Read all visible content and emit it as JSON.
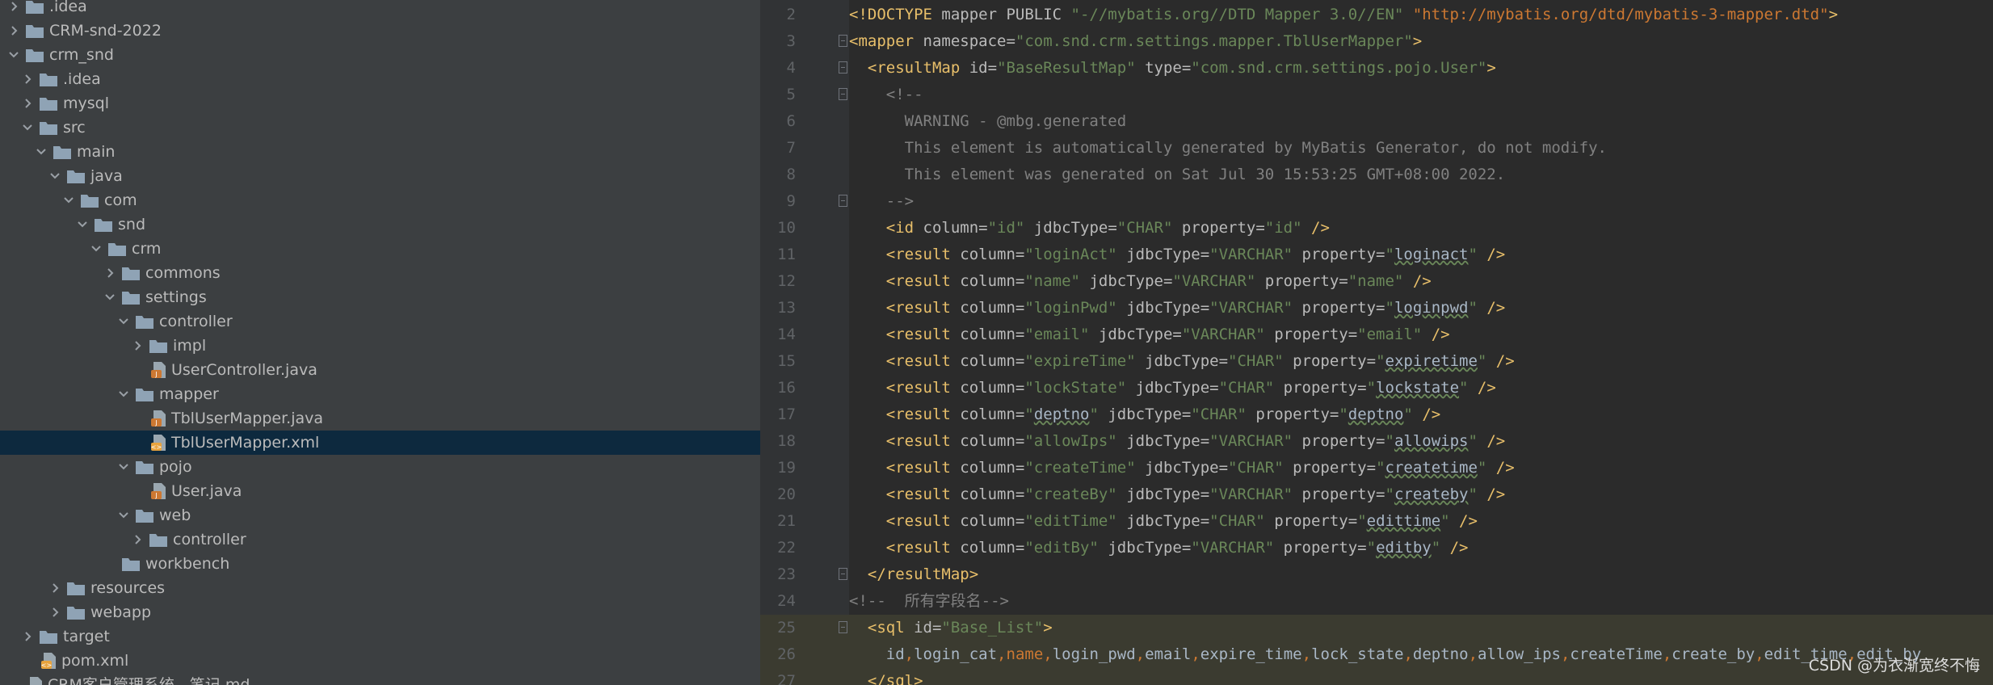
{
  "tree": [
    {
      "label": ".idea",
      "kind": "folder",
      "expanded": false,
      "depth": 0
    },
    {
      "label": "CRM-snd-2022",
      "kind": "folder",
      "expanded": false,
      "depth": 0
    },
    {
      "label": "crm_snd",
      "kind": "folder",
      "expanded": true,
      "depth": 0
    },
    {
      "label": ".idea",
      "kind": "folder",
      "expanded": false,
      "depth": 1
    },
    {
      "label": "mysql",
      "kind": "folder",
      "expanded": false,
      "depth": 1
    },
    {
      "label": "src",
      "kind": "folder",
      "expanded": true,
      "depth": 1
    },
    {
      "label": "main",
      "kind": "folder",
      "expanded": true,
      "depth": 2
    },
    {
      "label": "java",
      "kind": "folder",
      "expanded": true,
      "depth": 3
    },
    {
      "label": "com",
      "kind": "folder",
      "expanded": true,
      "depth": 4
    },
    {
      "label": "snd",
      "kind": "folder",
      "expanded": true,
      "depth": 5
    },
    {
      "label": "crm",
      "kind": "folder",
      "expanded": true,
      "depth": 6
    },
    {
      "label": "commons",
      "kind": "folder",
      "expanded": false,
      "depth": 7
    },
    {
      "label": "settings",
      "kind": "folder",
      "expanded": true,
      "depth": 7
    },
    {
      "label": "controller",
      "kind": "folder",
      "expanded": true,
      "depth": 8
    },
    {
      "label": "impl",
      "kind": "folder",
      "expanded": false,
      "depth": 9
    },
    {
      "label": "UserController.java",
      "kind": "java",
      "depth": 9
    },
    {
      "label": "mapper",
      "kind": "folder",
      "expanded": true,
      "depth": 8
    },
    {
      "label": "TblUserMapper.java",
      "kind": "java",
      "depth": 9
    },
    {
      "label": "TblUserMapper.xml",
      "kind": "xml",
      "depth": 9,
      "selected": true
    },
    {
      "label": "pojo",
      "kind": "folder",
      "expanded": true,
      "depth": 8
    },
    {
      "label": "User.java",
      "kind": "java",
      "depth": 9
    },
    {
      "label": "web",
      "kind": "folder",
      "expanded": true,
      "depth": 8
    },
    {
      "label": "controller",
      "kind": "folder",
      "expanded": false,
      "depth": 9
    },
    {
      "label": "workbench",
      "kind": "folder",
      "depth": 7
    },
    {
      "label": "resources",
      "kind": "folder",
      "expanded": false,
      "depth": 3
    },
    {
      "label": "webapp",
      "kind": "folder",
      "expanded": false,
      "depth": 3
    },
    {
      "label": "target",
      "kind": "folder",
      "expanded": false,
      "depth": 1
    },
    {
      "label": "pom.xml",
      "kind": "xml",
      "depth": 1
    },
    {
      "label": "CRM客户管理系统 - 笔记.md",
      "kind": "md",
      "depth": 0
    }
  ],
  "editor": {
    "lines": [
      {
        "n": "2",
        "fold": false,
        "tokens": [
          [
            "t",
            "<!DOCTYPE "
          ],
          [
            "a",
            "mapper PUBLIC "
          ],
          [
            "v",
            "\"-//mybatis.org//DTD Mapper 3.0//EN\" "
          ],
          [
            "u",
            "\"http://mybatis.org/dtd/mybatis-3-mapper.dtd\""
          ],
          [
            "t",
            ">"
          ]
        ]
      },
      {
        "n": "3",
        "fold": true,
        "tokens": [
          [
            "t",
            "<mapper "
          ],
          [
            "a",
            "namespace="
          ],
          [
            "v",
            "\"com.snd.crm.settings.mapper.TblUserMapper\""
          ],
          [
            "t",
            ">"
          ]
        ]
      },
      {
        "n": "4",
        "fold": true,
        "tokens": [
          [
            "f",
            "  "
          ],
          [
            "t",
            "<resultMap "
          ],
          [
            "a",
            "id="
          ],
          [
            "v",
            "\"BaseResultMap\" "
          ],
          [
            "a",
            "type="
          ],
          [
            "v",
            "\"com.snd.crm.settings.pojo.User\""
          ],
          [
            "t",
            ">"
          ]
        ]
      },
      {
        "n": "5",
        "fold": true,
        "tokens": [
          [
            "cm",
            "    <!--"
          ]
        ]
      },
      {
        "n": "6",
        "fold": false,
        "tokens": [
          [
            "cm",
            "      WARNING - @mbg.generated"
          ]
        ]
      },
      {
        "n": "7",
        "fold": false,
        "tokens": [
          [
            "cm",
            "      This element is automatically generated by MyBatis Generator, do not modify."
          ]
        ]
      },
      {
        "n": "8",
        "fold": false,
        "tokens": [
          [
            "cm",
            "      This element was generated on Sat Jul 30 15:53:25 GMT+08:00 2022."
          ]
        ]
      },
      {
        "n": "9",
        "fold": true,
        "tokens": [
          [
            "cm",
            "    -->"
          ]
        ]
      },
      {
        "n": "10",
        "fold": false,
        "tokens": [
          [
            "f",
            "    "
          ],
          [
            "t",
            "<id "
          ],
          [
            "a",
            "column="
          ],
          [
            "v",
            "\"id\" "
          ],
          [
            "a",
            "jdbcType="
          ],
          [
            "v",
            "\"CHAR\" "
          ],
          [
            "a",
            "property="
          ],
          [
            "v",
            "\"id\" "
          ],
          [
            "t",
            "/>"
          ]
        ]
      },
      {
        "n": "11",
        "fold": false,
        "tokens": [
          [
            "f",
            "    "
          ],
          [
            "t",
            "<result "
          ],
          [
            "a",
            "column="
          ],
          [
            "v",
            "\"loginAct\" "
          ],
          [
            "a",
            "jdbcType="
          ],
          [
            "v",
            "\"VARCHAR\" "
          ],
          [
            "a",
            "property="
          ],
          [
            "v",
            "\""
          ],
          [
            "sq",
            "loginact"
          ],
          [
            "v",
            "\" "
          ],
          [
            "t",
            "/>"
          ]
        ]
      },
      {
        "n": "12",
        "fold": false,
        "tokens": [
          [
            "f",
            "    "
          ],
          [
            "t",
            "<result "
          ],
          [
            "a",
            "column="
          ],
          [
            "v",
            "\"name\" "
          ],
          [
            "a",
            "jdbcType="
          ],
          [
            "v",
            "\"VARCHAR\" "
          ],
          [
            "a",
            "property="
          ],
          [
            "v",
            "\"name\" "
          ],
          [
            "t",
            "/>"
          ]
        ]
      },
      {
        "n": "13",
        "fold": false,
        "tokens": [
          [
            "f",
            "    "
          ],
          [
            "t",
            "<result "
          ],
          [
            "a",
            "column="
          ],
          [
            "v",
            "\"loginPwd\" "
          ],
          [
            "a",
            "jdbcType="
          ],
          [
            "v",
            "\"VARCHAR\" "
          ],
          [
            "a",
            "property="
          ],
          [
            "v",
            "\""
          ],
          [
            "sq",
            "loginpwd"
          ],
          [
            "v",
            "\" "
          ],
          [
            "t",
            "/>"
          ]
        ]
      },
      {
        "n": "14",
        "fold": false,
        "tokens": [
          [
            "f",
            "    "
          ],
          [
            "t",
            "<result "
          ],
          [
            "a",
            "column="
          ],
          [
            "v",
            "\"email\" "
          ],
          [
            "a",
            "jdbcType="
          ],
          [
            "v",
            "\"VARCHAR\" "
          ],
          [
            "a",
            "property="
          ],
          [
            "v",
            "\"email\" "
          ],
          [
            "t",
            "/>"
          ]
        ]
      },
      {
        "n": "15",
        "fold": false,
        "tokens": [
          [
            "f",
            "    "
          ],
          [
            "t",
            "<result "
          ],
          [
            "a",
            "column="
          ],
          [
            "v",
            "\"expireTime\" "
          ],
          [
            "a",
            "jdbcType="
          ],
          [
            "v",
            "\"CHAR\" "
          ],
          [
            "a",
            "property="
          ],
          [
            "v",
            "\""
          ],
          [
            "sq",
            "expiretime"
          ],
          [
            "v",
            "\" "
          ],
          [
            "t",
            "/>"
          ]
        ]
      },
      {
        "n": "16",
        "fold": false,
        "tokens": [
          [
            "f",
            "    "
          ],
          [
            "t",
            "<result "
          ],
          [
            "a",
            "column="
          ],
          [
            "v",
            "\"lockState\" "
          ],
          [
            "a",
            "jdbcType="
          ],
          [
            "v",
            "\"CHAR\" "
          ],
          [
            "a",
            "property="
          ],
          [
            "v",
            "\""
          ],
          [
            "sq",
            "lockstate"
          ],
          [
            "v",
            "\" "
          ],
          [
            "t",
            "/>"
          ]
        ]
      },
      {
        "n": "17",
        "fold": false,
        "tokens": [
          [
            "f",
            "    "
          ],
          [
            "t",
            "<result "
          ],
          [
            "a",
            "column="
          ],
          [
            "v",
            "\""
          ],
          [
            "sq",
            "deptno"
          ],
          [
            "v",
            "\" "
          ],
          [
            "a",
            "jdbcType="
          ],
          [
            "v",
            "\"CHAR\" "
          ],
          [
            "a",
            "property="
          ],
          [
            "v",
            "\""
          ],
          [
            "sq",
            "deptno"
          ],
          [
            "v",
            "\" "
          ],
          [
            "t",
            "/>"
          ]
        ]
      },
      {
        "n": "18",
        "fold": false,
        "tokens": [
          [
            "f",
            "    "
          ],
          [
            "t",
            "<result "
          ],
          [
            "a",
            "column="
          ],
          [
            "v",
            "\"allowIps\" "
          ],
          [
            "a",
            "jdbcType="
          ],
          [
            "v",
            "\"VARCHAR\" "
          ],
          [
            "a",
            "property="
          ],
          [
            "v",
            "\""
          ],
          [
            "sq",
            "allowips"
          ],
          [
            "v",
            "\" "
          ],
          [
            "t",
            "/>"
          ]
        ]
      },
      {
        "n": "19",
        "fold": false,
        "tokens": [
          [
            "f",
            "    "
          ],
          [
            "t",
            "<result "
          ],
          [
            "a",
            "column="
          ],
          [
            "v",
            "\"createTime\" "
          ],
          [
            "a",
            "jdbcType="
          ],
          [
            "v",
            "\"CHAR\" "
          ],
          [
            "a",
            "property="
          ],
          [
            "v",
            "\""
          ],
          [
            "sq",
            "createtime"
          ],
          [
            "v",
            "\" "
          ],
          [
            "t",
            "/>"
          ]
        ]
      },
      {
        "n": "20",
        "fold": false,
        "tokens": [
          [
            "f",
            "    "
          ],
          [
            "t",
            "<result "
          ],
          [
            "a",
            "column="
          ],
          [
            "v",
            "\"createBy\" "
          ],
          [
            "a",
            "jdbcType="
          ],
          [
            "v",
            "\"VARCHAR\" "
          ],
          [
            "a",
            "property="
          ],
          [
            "v",
            "\""
          ],
          [
            "sq",
            "createby"
          ],
          [
            "v",
            "\" "
          ],
          [
            "t",
            "/>"
          ]
        ]
      },
      {
        "n": "21",
        "fold": false,
        "tokens": [
          [
            "f",
            "    "
          ],
          [
            "t",
            "<result "
          ],
          [
            "a",
            "column="
          ],
          [
            "v",
            "\"editTime\" "
          ],
          [
            "a",
            "jdbcType="
          ],
          [
            "v",
            "\"CHAR\" "
          ],
          [
            "a",
            "property="
          ],
          [
            "v",
            "\""
          ],
          [
            "sq",
            "edittime"
          ],
          [
            "v",
            "\" "
          ],
          [
            "t",
            "/>"
          ]
        ]
      },
      {
        "n": "22",
        "fold": false,
        "tokens": [
          [
            "f",
            "    "
          ],
          [
            "t",
            "<result "
          ],
          [
            "a",
            "column="
          ],
          [
            "v",
            "\"editBy\" "
          ],
          [
            "a",
            "jdbcType="
          ],
          [
            "v",
            "\"VARCHAR\" "
          ],
          [
            "a",
            "property="
          ],
          [
            "v",
            "\""
          ],
          [
            "sq",
            "editby"
          ],
          [
            "v",
            "\" "
          ],
          [
            "t",
            "/>"
          ]
        ]
      },
      {
        "n": "23",
        "fold": true,
        "tokens": [
          [
            "f",
            "  "
          ],
          [
            "t",
            "</resultMap>"
          ]
        ]
      },
      {
        "n": "24",
        "fold": false,
        "tokens": [
          [
            "cm",
            "<!--  所有字段名-->"
          ]
        ]
      },
      {
        "n": "25",
        "fold": true,
        "hl": true,
        "tokens": [
          [
            "f",
            "  "
          ],
          [
            "t",
            "<sql "
          ],
          [
            "a",
            "id="
          ],
          [
            "v",
            "\"Base_List\""
          ],
          [
            "t",
            ">"
          ]
        ]
      },
      {
        "n": "26",
        "fold": false,
        "hl": true,
        "tokens": [
          [
            "f",
            "    id"
          ],
          [
            "w",
            ","
          ],
          [
            "f",
            "login_cat"
          ],
          [
            "w",
            ","
          ],
          [
            "k",
            "name"
          ],
          [
            "w",
            ","
          ],
          [
            "f",
            "login_pwd"
          ],
          [
            "w",
            ","
          ],
          [
            "f",
            "email"
          ],
          [
            "w",
            ","
          ],
          [
            "f",
            "expire_time"
          ],
          [
            "w",
            ","
          ],
          [
            "f",
            "lock_state"
          ],
          [
            "w",
            ","
          ],
          [
            "f",
            "deptno"
          ],
          [
            "w",
            ","
          ],
          [
            "f",
            "allow_ips"
          ],
          [
            "w",
            ","
          ],
          [
            "f",
            "createTime"
          ],
          [
            "w",
            ","
          ],
          [
            "f",
            "create_by"
          ],
          [
            "w",
            ","
          ],
          [
            "f",
            "edit_time"
          ],
          [
            "w",
            ","
          ],
          [
            "f",
            "edit_by"
          ]
        ]
      },
      {
        "n": "27",
        "fold": false,
        "hl": true,
        "tokens": [
          [
            "f",
            "  "
          ],
          [
            "t",
            "</sql>"
          ]
        ]
      }
    ]
  },
  "watermark": "CSDN @为衣渐宽终不悔",
  "colors": {
    "tree_bg": "#3c3f41",
    "selection": "#0d293e",
    "editor_bg": "#2b2b2b",
    "tag": "#e8bf6a",
    "value": "#6a8759",
    "comment": "#808080"
  }
}
